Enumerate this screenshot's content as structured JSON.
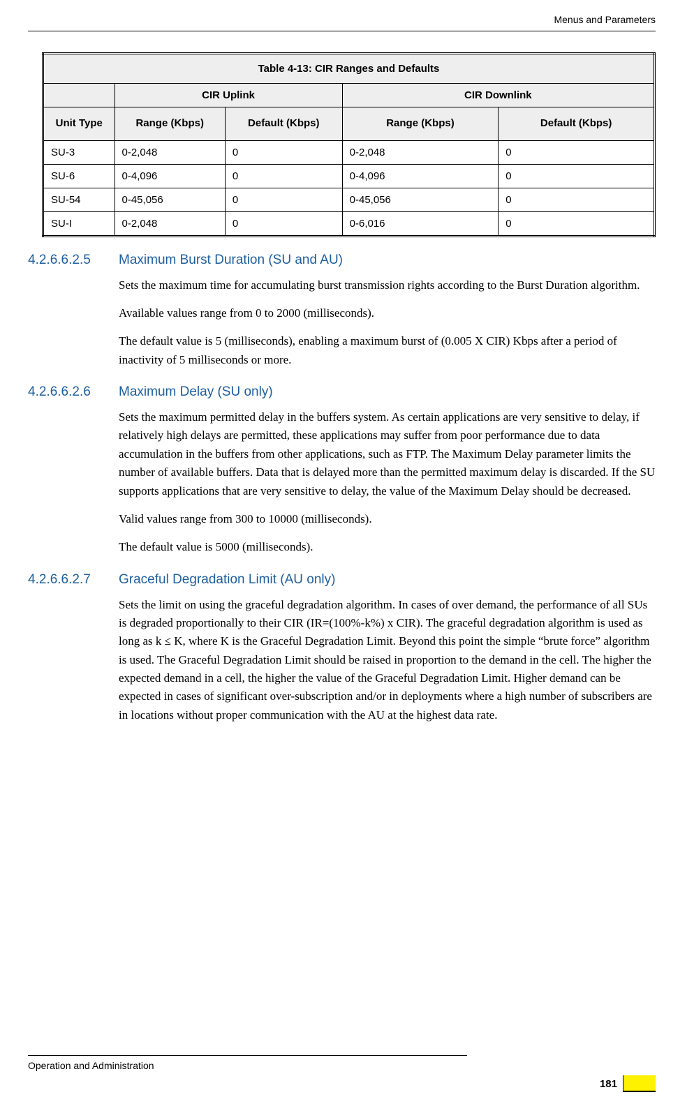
{
  "header": {
    "right": "Menus and Parameters"
  },
  "table": {
    "title": "Table 4-13: CIR Ranges and Defaults",
    "group_blank": "",
    "group_uplink": "CIR Uplink",
    "group_downlink": "CIR Downlink",
    "hdr_unit": "Unit Type",
    "hdr_up_range": "Range (Kbps)",
    "hdr_up_default": "Default (Kbps)",
    "hdr_dn_range": "Range (Kbps)",
    "hdr_dn_default": "Default (Kbps)",
    "rows": [
      {
        "unit": "SU-3",
        "up_range": "0-2,048",
        "up_default": "0",
        "dn_range": "0-2,048",
        "dn_default": "0"
      },
      {
        "unit": "SU-6",
        "up_range": "0-4,096",
        "up_default": "0",
        "dn_range": "0-4,096",
        "dn_default": "0"
      },
      {
        "unit": "SU-54",
        "up_range": "0-45,056",
        "up_default": "0",
        "dn_range": "0-45,056",
        "dn_default": "0"
      },
      {
        "unit": "SU-I",
        "up_range": "0-2,048",
        "up_default": "0",
        "dn_range": "0-6,016",
        "dn_default": "0"
      }
    ]
  },
  "sections": [
    {
      "num": "4.2.6.6.2.5",
      "title": "Maximum Burst Duration (SU and AU)",
      "paras": [
        "Sets the maximum time for accumulating burst transmission rights according to the Burst Duration algorithm.",
        "Available values range from 0 to 2000 (milliseconds).",
        "The default value is 5 (milliseconds), enabling a maximum burst of (0.005 X CIR) Kbps after a period of inactivity of 5 milliseconds or more."
      ]
    },
    {
      "num": "4.2.6.6.2.6",
      "title": "Maximum Delay (SU only)",
      "paras": [
        "Sets the maximum permitted delay in the buffers system. As certain applications are very sensitive to delay, if relatively high delays are permitted, these applications may suffer from poor performance due to data accumulation in the buffers from other applications, such as FTP. The Maximum Delay parameter limits the number of available buffers. Data that is delayed more than the permitted maximum delay is discarded. If the SU supports applications that are very sensitive to delay, the value of the Maximum Delay should be decreased.",
        "Valid values range from 300 to 10000 (milliseconds).",
        "The default value is 5000 (milliseconds)."
      ]
    },
    {
      "num": "4.2.6.6.2.7",
      "title": "Graceful Degradation Limit (AU only)",
      "paras": [
        "Sets the limit on using the graceful degradation algorithm. In cases of over demand, the performance of all SUs is degraded proportionally to their CIR (IR=(100%-k%) x CIR). The graceful degradation algorithm is used as long as k ≤ K, where K is the Graceful Degradation Limit. Beyond this point the simple “brute force” algorithm is used. The Graceful Degradation Limit should be raised in proportion to the demand in the cell. The higher the expected demand in a cell, the higher the value of the Graceful Degradation Limit. Higher demand can be expected in cases of significant over-subscription and/or in deployments where a high number of subscribers are in locations without proper communication with the AU at the highest data rate."
      ]
    }
  ],
  "footer": {
    "left": "Operation and Administration",
    "page": "181"
  }
}
